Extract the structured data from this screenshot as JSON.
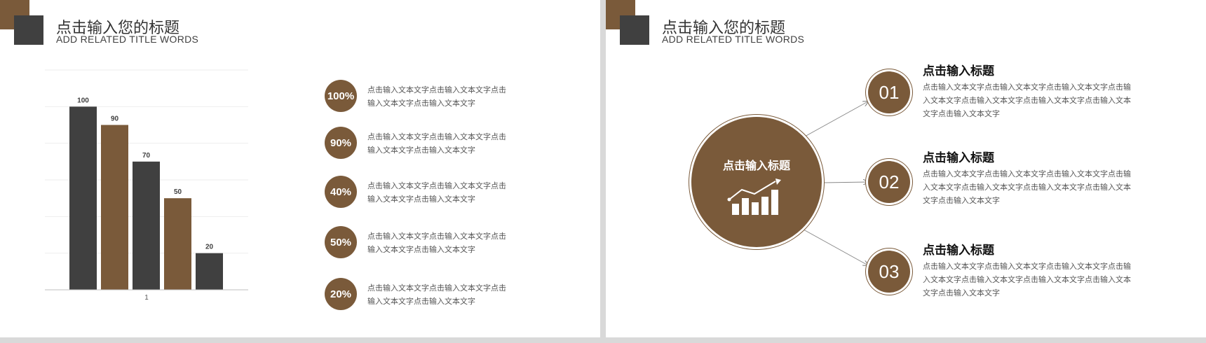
{
  "left_slide": {
    "title": "点击输入您的标题",
    "subtitle": "ADD RELATED TITLE WORDS",
    "chart_data": {
      "type": "bar",
      "categories": [
        "1"
      ],
      "series": [
        {
          "values": [
            100
          ],
          "color": "#404040"
        },
        {
          "values": [
            90
          ],
          "color": "#7a5a3a"
        },
        {
          "values": [
            70
          ],
          "color": "#404040"
        },
        {
          "values": [
            50
          ],
          "color": "#7a5a3a"
        },
        {
          "values": [
            20
          ],
          "color": "#404040"
        }
      ],
      "ylim": [
        0,
        120
      ],
      "grid": true,
      "data_labels": [
        "100",
        "90",
        "70",
        "50",
        "20"
      ]
    },
    "items": [
      {
        "pct": "100%",
        "text": "点击输入文本文字点击输入文本文字点击输入文本文字点击输入文本文字"
      },
      {
        "pct": "90%",
        "text": "点击输入文本文字点击输入文本文字点击输入文本文字点击输入文本文字"
      },
      {
        "pct": "40%",
        "text": "点击输入文本文字点击输入文本文字点击输入文本文字点击输入文本文字"
      },
      {
        "pct": "50%",
        "text": "点击输入文本文字点击输入文本文字点击输入文本文字点击输入文本文字"
      },
      {
        "pct": "20%",
        "text": "点击输入文本文字点击输入文本文字点击输入文本文字点击输入文本文字"
      }
    ]
  },
  "right_slide": {
    "title": "点击输入您的标题",
    "subtitle": "ADD RELATED TITLE WORDS",
    "hub_label": "点击输入标题",
    "hub_icon": "growth-chart-icon",
    "items": [
      {
        "num": "01",
        "title": "点击输入标题",
        "text": "点击输入文本文字点击输入文本文字点击输入文本文字点击输入文本文字点击输入文本文字点击输入文本文字点击输入文本文字点击输入文本文字"
      },
      {
        "num": "02",
        "title": "点击输入标题",
        "text": "点击输入文本文字点击输入文本文字点击输入文本文字点击输入文本文字点击输入文本文字点击输入文本文字点击输入文本文字点击输入文本文字"
      },
      {
        "num": "03",
        "title": "点击输入标题",
        "text": "点击输入文本文字点击输入文本文字点击输入文本文字点击输入文本文字点击输入文本文字点击输入文本文字点击输入文本文字点击输入文本文字"
      }
    ]
  },
  "colors": {
    "accent": "#7a5a3a",
    "dark": "#404040",
    "background": "#ffffff",
    "frame": "#d9d9d9"
  }
}
